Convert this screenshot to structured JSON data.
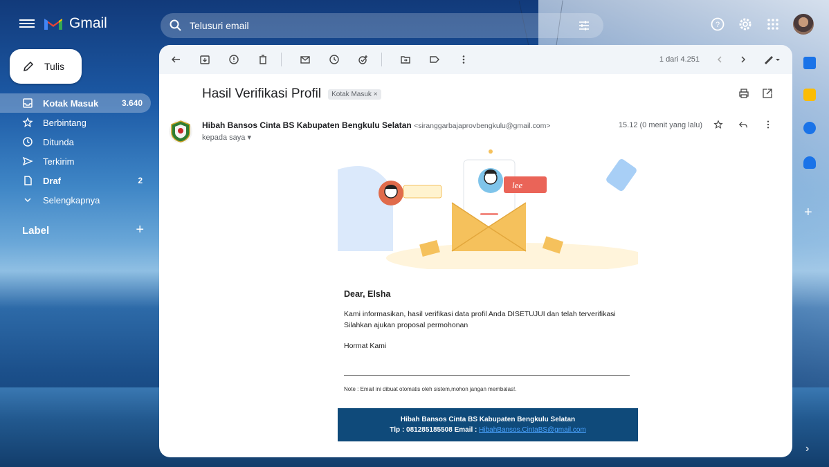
{
  "app": {
    "name": "Gmail"
  },
  "search": {
    "placeholder": "Telusuri email"
  },
  "sidebar": {
    "compose_label": "Tulis",
    "items": [
      {
        "label": "Kotak Masuk",
        "count": "3.640"
      },
      {
        "label": "Berbintang",
        "count": ""
      },
      {
        "label": "Ditunda",
        "count": ""
      },
      {
        "label": "Terkirim",
        "count": ""
      },
      {
        "label": "Draf",
        "count": "2"
      },
      {
        "label": "Selengkapnya",
        "count": ""
      }
    ],
    "labels_title": "Label"
  },
  "toolbar": {
    "paging": "1 dari 4.251"
  },
  "email": {
    "subject": "Hasil Verifikasi Profil",
    "label_chip": "Kotak Masuk",
    "sender_name": "Hibah Bansos Cinta BS Kabupaten Bengkulu Selatan",
    "sender_email": "<siranggarbajaprovbengkulu@gmail.com>",
    "to_line": "kepada saya",
    "time": "15.12 (0 menit yang lalu)",
    "greeting": "Dear, Elsha",
    "line1": "Kami informasikan, hasil verifikasi data profil Anda DISETUJUI dan telah terverifikasi",
    "line2": "Silahkan ajukan proposal permohonan",
    "signoff": "Hormat Kami",
    "note": "Note : Email ini dibuat otomatis oleh sistem,mohon jangan membalas!.",
    "footer_name": "Hibah Bansos Cinta BS Kabupaten Bengkulu Selatan",
    "footer_contact": "Tlp : 081285185508 Email :",
    "footer_email": "HibahBansos.CintaBS@gmail.com"
  },
  "colors": {
    "footer_bg": "#0f4a7a",
    "accent": "#1a73e8"
  }
}
